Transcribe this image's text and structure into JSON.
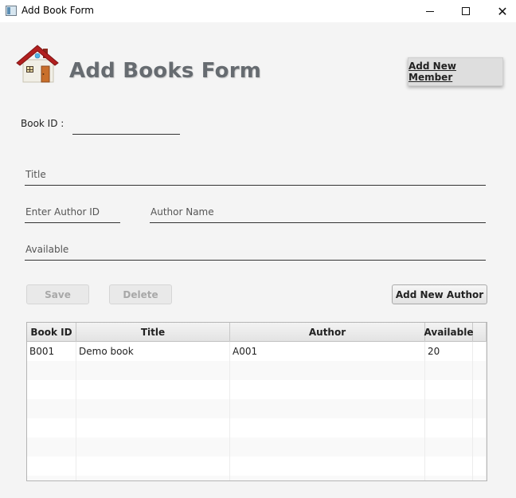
{
  "window": {
    "title": "Add Book Form",
    "app_icon": "app-window-icon",
    "controls": {
      "minimize": "minimize-icon",
      "maximize": "maximize-icon",
      "close": "close-icon",
      "close_glyph": "✕"
    }
  },
  "header": {
    "title": "Add Books Form",
    "logo_icon": "house-icon",
    "member_button": "Add New Member"
  },
  "form": {
    "book_id_label": "Book ID :",
    "book_id_value": "",
    "title_placeholder": "Title",
    "author_id_placeholder": "Enter Author ID",
    "author_name_placeholder": "Author Name",
    "available_placeholder": "Available"
  },
  "buttons": {
    "save": "Save",
    "delete": "Delete",
    "add_author": "Add New Author"
  },
  "table": {
    "columns": [
      "Book ID",
      "Title",
      "Author",
      "Available"
    ],
    "rows": [
      [
        "B001",
        "Demo book",
        "A001",
        "20"
      ]
    ]
  },
  "colors": {
    "title_text": "#666b70",
    "background": "#f4f4f4",
    "house_roof": "#b21f1f",
    "house_wall": "#f1efe6"
  }
}
